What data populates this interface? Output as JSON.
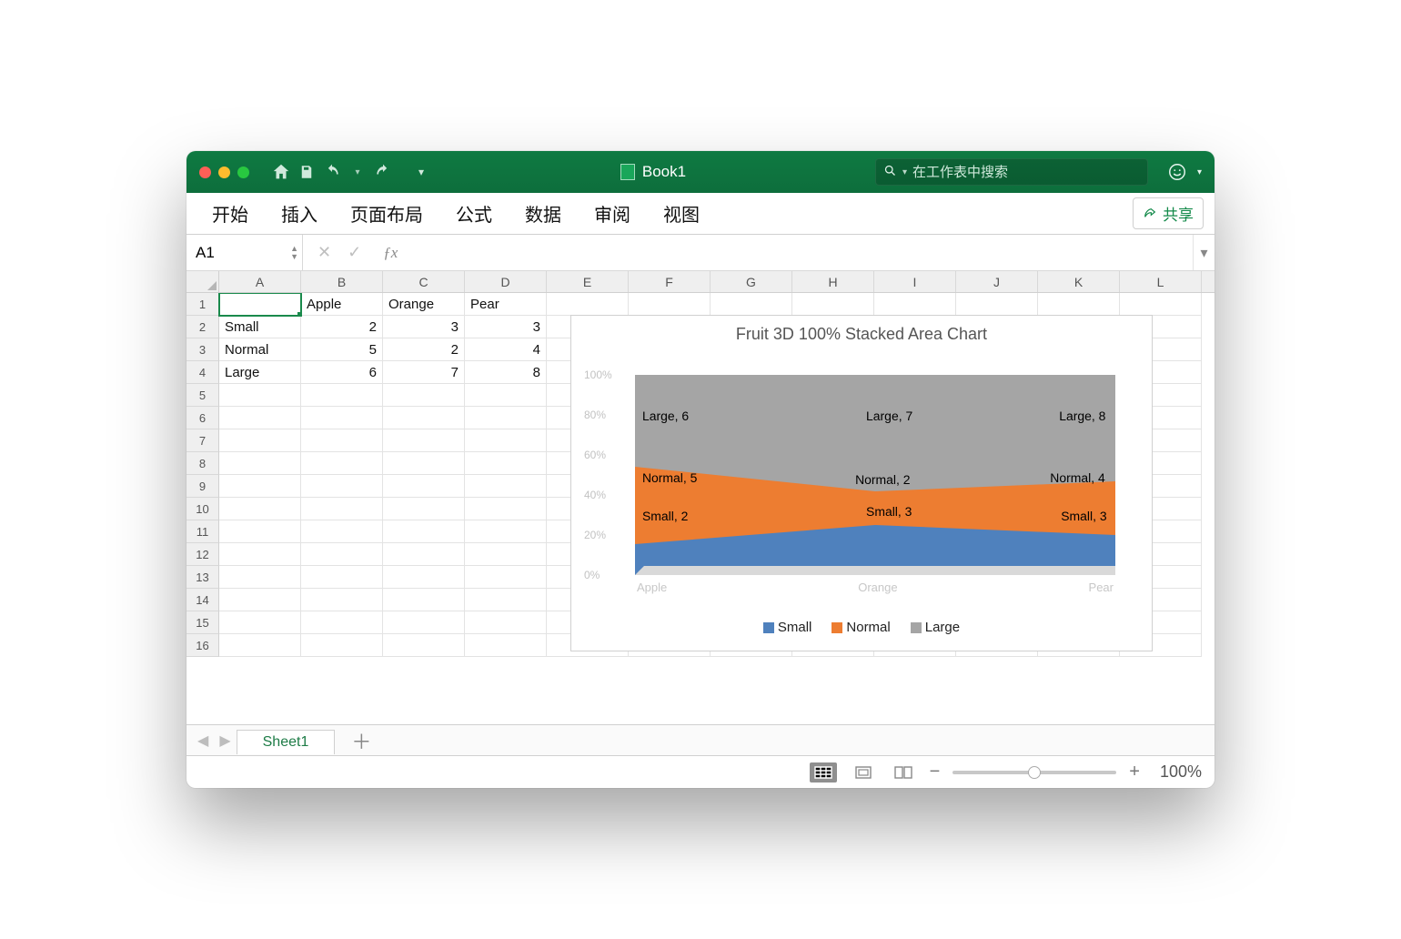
{
  "titlebar": {
    "document_title": "Book1",
    "search_placeholder": "在工作表中搜索"
  },
  "ribbon": {
    "tabs": [
      "开始",
      "插入",
      "页面布局",
      "公式",
      "数据",
      "审阅",
      "视图"
    ],
    "share_label": "共享"
  },
  "fxrow": {
    "namebox_value": "A1",
    "fx_label": "ƒx",
    "formula": ""
  },
  "grid": {
    "columns": [
      "A",
      "B",
      "C",
      "D",
      "E",
      "F",
      "G",
      "H",
      "I",
      "J",
      "K",
      "L"
    ],
    "row_count": 16,
    "selected_cell": "A1",
    "cells": {
      "B1": "Apple",
      "C1": "Orange",
      "D1": "Pear",
      "A2": "Small",
      "B2": "2",
      "C2": "3",
      "D2": "3",
      "A3": "Normal",
      "B3": "5",
      "C3": "2",
      "D3": "4",
      "A4": "Large",
      "B4": "6",
      "C4": "7",
      "D4": "8"
    }
  },
  "chart": {
    "title": "Fruit 3D 100% Stacked Area Chart",
    "y_ticks": [
      "100%",
      "80%",
      "60%",
      "40%",
      "20%",
      "0%"
    ],
    "x_labels": [
      "Apple",
      "Orange",
      "Pear"
    ],
    "legend": [
      "Small",
      "Normal",
      "Large"
    ],
    "data_labels": {
      "large": [
        "Large, 6",
        "Large, 7",
        "Large, 8"
      ],
      "normal": [
        "Normal, 5",
        "Normal, 2",
        "Normal, 4"
      ],
      "small": [
        "Small, 2",
        "Small, 3",
        "Small, 3"
      ]
    }
  },
  "chart_data": {
    "type": "area",
    "stacked": "100%",
    "title": "Fruit 3D 100% Stacked Area Chart",
    "categories": [
      "Apple",
      "Orange",
      "Pear"
    ],
    "series": [
      {
        "name": "Small",
        "values": [
          2,
          3,
          3
        ]
      },
      {
        "name": "Normal",
        "values": [
          5,
          2,
          4
        ]
      },
      {
        "name": "Large",
        "values": [
          6,
          7,
          8
        ]
      }
    ],
    "ylabel": "percent",
    "ylim": [
      0,
      100
    ]
  },
  "sheetbar": {
    "active_sheet": "Sheet1"
  },
  "statusbar": {
    "zoom": "100%"
  }
}
